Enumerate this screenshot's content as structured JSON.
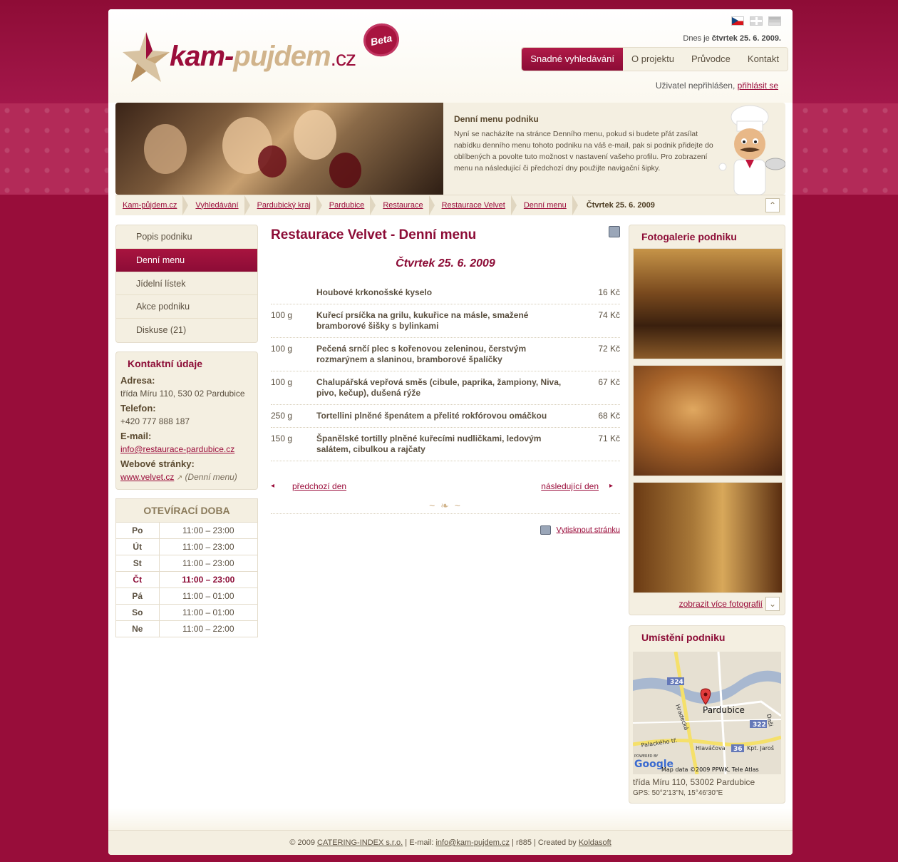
{
  "header": {
    "logo_main": "kam-",
    "logo_second": "pujdem",
    "logo_tld": ".cz",
    "beta": "Beta",
    "date_prefix": "Dnes je",
    "date_value": "čtvrtek 25. 6. 2009.",
    "nav": [
      "Snadné vyhledávání",
      "O projektu",
      "Průvodce",
      "Kontakt"
    ],
    "user_text": "Uživatel nepřihlášen,",
    "login_link": "přihlásit se"
  },
  "banner": {
    "title": "Denní menu podniku",
    "text": "Nyní se nacházíte na stránce Denního menu, pokud si budete přát zasílat nabídku denního menu tohoto podniku na váš e-mail, pak si podnik přidejte do oblíbených a povolte tuto možnost v nastavení vašeho profilu. Pro zobrazení menu na následující či předchozí dny použijte navigační šipky."
  },
  "breadcrumbs": [
    "Kam-půjdem.cz",
    "Vyhledávání",
    "Pardubický kraj",
    "Pardubice",
    "Restaurace",
    "Restaurace Velvet",
    "Denní menu"
  ],
  "breadcrumb_current": "Čtvrtek 25. 6. 2009",
  "sidebar": {
    "menu": [
      "Popis podniku",
      "Denní menu",
      "Jídelní lístek",
      "Akce podniku",
      "Diskuse (21)"
    ],
    "contact_title": "Kontaktní údaje",
    "address_label": "Adresa:",
    "address": "třída Míru 110, 530 02 Pardubice",
    "phone_label": "Telefon:",
    "phone": "+420 777 888 187",
    "email_label": "E-mail:",
    "email": "info@restaurace-pardubice.cz",
    "web_label": "Webové stránky:",
    "web": "www.velvet.cz",
    "web_note": "(Denní menu)",
    "hours_title": "OTEVÍRACÍ DOBA",
    "hours": [
      {
        "day": "Po",
        "time": "11:00 – 23:00"
      },
      {
        "day": "Út",
        "time": "11:00 – 23:00"
      },
      {
        "day": "St",
        "time": "11:00 – 23:00"
      },
      {
        "day": "Čt",
        "time": "11:00 – 23:00"
      },
      {
        "day": "Pá",
        "time": "11:00 – 01:00"
      },
      {
        "day": "So",
        "time": "11:00 – 01:00"
      },
      {
        "day": "Ne",
        "time": "11:00 – 22:00"
      }
    ]
  },
  "main": {
    "title": "Restaurace Velvet - Denní menu",
    "day": "Čtvrtek 25. 6. 2009",
    "dishes": [
      {
        "weight": "",
        "name": "Houbové krkonošské kyselo",
        "price": "16 Kč"
      },
      {
        "weight": "100 g",
        "name": "Kuřecí prsíčka na grilu, kukuřice na másle, smažené bramborové šišky s bylinkami",
        "price": "74 Kč"
      },
      {
        "weight": "100 g",
        "name": "Pečená srnčí plec s kořenovou zeleninou, čerstvým rozmarýnem a slaninou, bramborové špalíčky",
        "price": "72 Kč"
      },
      {
        "weight": "100 g",
        "name": "Chalupářská vepřová směs (cibule, paprika, žampiony, Niva, pivo, kečup), dušená rýže",
        "price": "67 Kč"
      },
      {
        "weight": "250 g",
        "name": "Tortellini plněné špenátem a přelité rokfórovou omáčkou",
        "price": "68 Kč"
      },
      {
        "weight": "150 g",
        "name": "Španělské tortilly plněné kuřecími nudličkami, ledovým salátem, cibulkou a rajčaty",
        "price": "71 Kč"
      }
    ],
    "prev": "předchozí den",
    "next": "následující den",
    "print": "Vytisknout stránku"
  },
  "right": {
    "gallery_title": "Fotogalerie podniku",
    "more_photos": "zobrazit více fotografií",
    "map_title": "Umístění podniku",
    "map_city": "Pardubice",
    "map_credit": "Map data ©2009 PPWK, Tele Atlas",
    "map_powered": "POWERED BY",
    "map_google": "Google",
    "map_labels": [
      "324",
      "322",
      "36",
      "Hradecká",
      "Palackého tř.",
      "Hlaváčova",
      "Kpt. Jaroš",
      "Daši"
    ],
    "address": "třída Míru 110, 53002 Pardubice",
    "gps": "GPS: 50°2'13\"N, 15°46'30\"E"
  },
  "footer": {
    "copy": "© 2009",
    "company": "CATERING-INDEX s.r.o.",
    "email_prefix": "| E-mail:",
    "email": "info@kam-pujdem.cz",
    "rev": "| r885 | Created by",
    "creator": "Koldasoft"
  }
}
